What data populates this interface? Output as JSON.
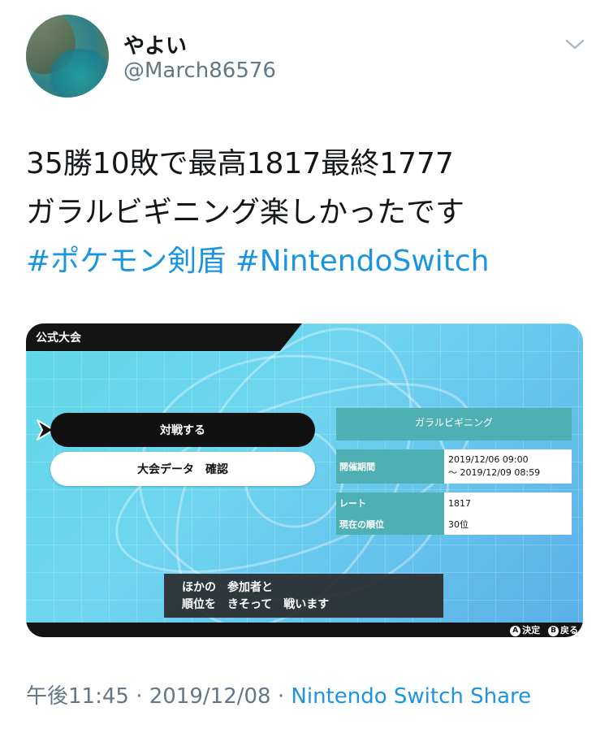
{
  "user": {
    "display_name": "やよい",
    "handle": "@March86576"
  },
  "tweet": {
    "line1": "35勝10敗で最高1817最終1777",
    "line2": "ガラルビギニング楽しかったです",
    "hashtags": [
      "#ポケモン剣盾",
      "#NintendoSwitch"
    ]
  },
  "game_screen": {
    "header": "公式大会",
    "menu": [
      "対戦する",
      "大会データ　確認"
    ],
    "competition_name": "ガラルビギニング",
    "info": {
      "period_label": "開催期間",
      "period_start": "2019/12/06 09:00",
      "period_end": "～ 2019/12/09 08:59",
      "rate_label": "レート",
      "rate_value": "1817",
      "rank_label": "現在の順位",
      "rank_value": "30位"
    },
    "message_line1": "ほかの　参加者と",
    "message_line2": "順位を　きそって　戦います",
    "controls": {
      "a_glyph": "A",
      "a_label": "決定",
      "b_glyph": "B",
      "b_label": "戻る"
    }
  },
  "meta": {
    "time": "午後11:45",
    "sep1": " · ",
    "date": "2019/12/08",
    "sep2": " · ",
    "source": "Nintendo Switch Share"
  },
  "colors": {
    "link": "#1b95e0",
    "secondary_text": "#657786",
    "game_teal": "#4fb0b4"
  },
  "icons": {
    "menu_caret": "chevron-down-icon",
    "cursor": "arrow-cursor-icon"
  }
}
